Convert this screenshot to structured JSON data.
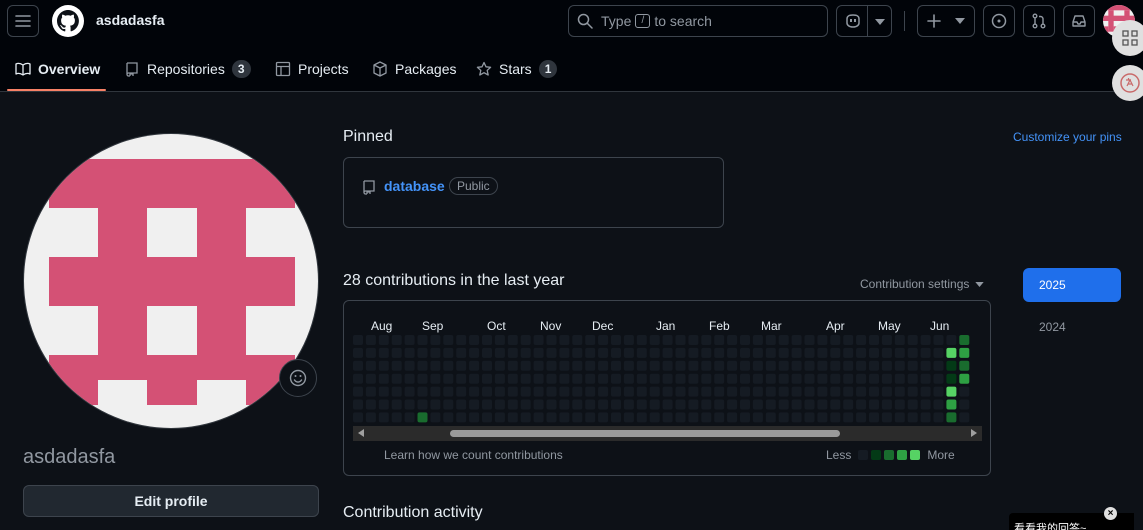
{
  "header": {
    "username": "asdadasfa",
    "search_prefix": "Type",
    "search_key": "/",
    "search_suffix": "to search"
  },
  "tabs": [
    {
      "label": "Overview"
    },
    {
      "label": "Repositories",
      "count": "3"
    },
    {
      "label": "Projects"
    },
    {
      "label": "Packages"
    },
    {
      "label": "Stars",
      "count": "1"
    }
  ],
  "profile": {
    "login": "asdadasfa",
    "edit_label": "Edit profile"
  },
  "pinned": {
    "title": "Pinned",
    "customize": "Customize your pins",
    "repo_name": "database",
    "repo_visibility": "Public"
  },
  "contributions": {
    "title": "28 contributions in the last year",
    "settings": "Contribution settings",
    "months": [
      "Aug",
      "Sep",
      "Oct",
      "Nov",
      "Dec",
      "Jan",
      "Feb",
      "Mar",
      "Apr",
      "May",
      "Jun"
    ],
    "learn": "Learn how we count contributions",
    "less": "Less",
    "more": "More",
    "levels": [
      "#151b23",
      "#033a16",
      "#196c2e",
      "#2ea043",
      "#56d364"
    ],
    "cells": [
      {
        "week": 5,
        "day": 6,
        "level": 2
      },
      {
        "week": 46,
        "day": 1,
        "level": 4
      },
      {
        "week": 46,
        "day": 2,
        "level": 1
      },
      {
        "week": 46,
        "day": 3,
        "level": 1
      },
      {
        "week": 46,
        "day": 4,
        "level": 4
      },
      {
        "week": 46,
        "day": 5,
        "level": 3
      },
      {
        "week": 46,
        "day": 6,
        "level": 2
      },
      {
        "week": 47,
        "day": 0,
        "level": 2
      },
      {
        "week": 47,
        "day": 1,
        "level": 3
      },
      {
        "week": 47,
        "day": 2,
        "level": 2
      },
      {
        "week": 47,
        "day": 3,
        "level": 3
      }
    ],
    "weeks": 48,
    "years": [
      "2025",
      "2024"
    ]
  },
  "activity": {
    "title": "Contribution activity"
  },
  "popup": {
    "text": "看看我的回答~"
  },
  "colors": {
    "accent": "#1f6feb",
    "link": "#4493f8",
    "tab_underline": "#f78166",
    "avatar_pink": "#d45175",
    "avatar_bg": "#f0f0f0"
  }
}
